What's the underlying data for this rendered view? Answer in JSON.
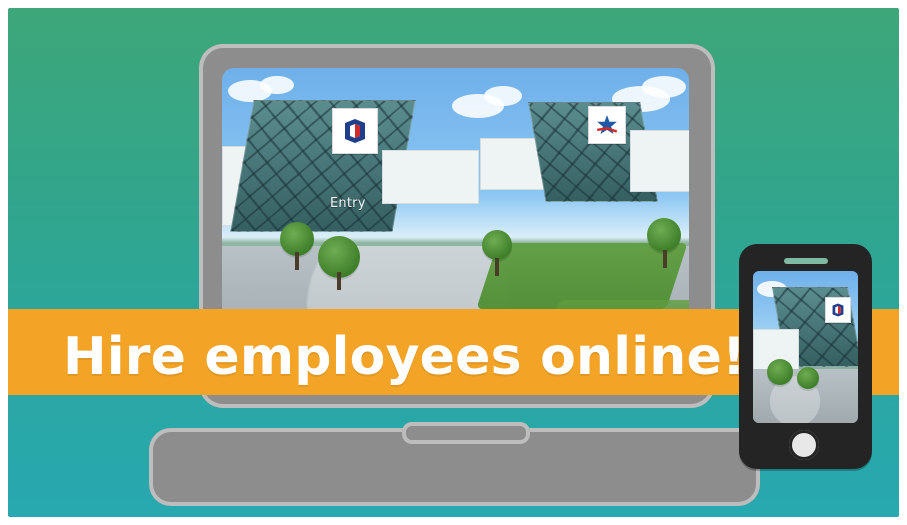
{
  "banner": {
    "text": "Hire employees online!"
  },
  "screen": {
    "sign_text": "Entry"
  },
  "colors": {
    "background_top": "#3ea77a",
    "background_bottom": "#28a8b0",
    "banner": "#f3a427",
    "device_gray": "#8d8d8d",
    "phone_black": "#242424"
  },
  "icons": {
    "left_logo": "company-logo-icon",
    "right_logo": "star-flag-logo-icon"
  }
}
